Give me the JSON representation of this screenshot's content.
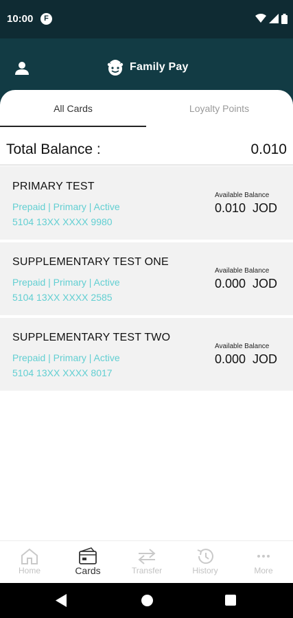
{
  "status_bar": {
    "time": "10:00",
    "app_icon_letter": "F",
    "icons": [
      "wifi-icon",
      "signal-icon",
      "battery-icon"
    ]
  },
  "header": {
    "title": "Family Pay",
    "icons": [
      "user-icon",
      "family-pay-logo"
    ]
  },
  "tabs": [
    {
      "label": "All Cards",
      "selected": true
    },
    {
      "label": "Loyalty Points",
      "selected": false
    }
  ],
  "total": {
    "label": "Total Balance :",
    "value": "0.010"
  },
  "cards": [
    {
      "name": "PRIMARY TEST",
      "meta": "Prepaid | Primary | Active",
      "number": "5104 13XX XXXX 9980",
      "balance_label": "Available Balance",
      "balance": "0.010",
      "currency": "JOD"
    },
    {
      "name": "SUPPLEMENTARY TEST ONE",
      "meta": "Prepaid | Primary | Active",
      "number": "5104 13XX XXXX 2585",
      "balance_label": "Available Balance",
      "balance": "0.000",
      "currency": "JOD"
    },
    {
      "name": "SUPPLEMENTARY TEST TWO",
      "meta": "Prepaid | Primary | Active",
      "number": "5104 13XX XXXX 8017",
      "balance_label": "Available Balance",
      "balance": "0.000",
      "currency": "JOD"
    }
  ],
  "bottom_nav": [
    {
      "label": "Home",
      "icon": "home-icon",
      "active": false
    },
    {
      "label": "Cards",
      "icon": "card-icon",
      "active": true
    },
    {
      "label": "Transfer",
      "icon": "transfer-icon",
      "active": false
    },
    {
      "label": "History",
      "icon": "history-icon",
      "active": false
    },
    {
      "label": "More",
      "icon": "more-icon",
      "active": false
    }
  ],
  "colors": {
    "header": "#123b44",
    "status_bar": "#0f2b33",
    "accent_teal": "#62cfd2",
    "card_background": "#f2f2f2"
  }
}
